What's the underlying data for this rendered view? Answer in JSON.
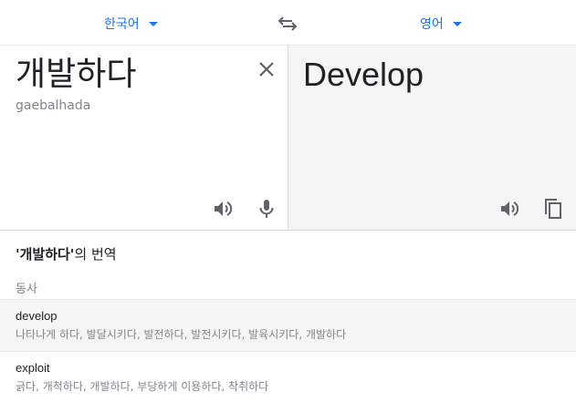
{
  "lang_bar": {
    "source_language": "한국어",
    "target_language": "영어"
  },
  "source": {
    "text": "개발하다",
    "romanization": "gaebalhada"
  },
  "target": {
    "text": "Develop"
  },
  "dictionary": {
    "title_quoted": "개발하다",
    "title_open_quote": "'",
    "title_close_quote": "'",
    "title_suffix": "의 번역",
    "part_of_speech": "동사",
    "entries": [
      {
        "word": "develop",
        "meanings": "나타나게 하다, 발달시키다, 발전하다, 발전시키다, 발육시키다, 개발하다"
      },
      {
        "word": "exploit",
        "meanings": "긁다, 개척하다, 개발하다, 부당하게 이용하다, 착취하다"
      }
    ]
  },
  "colors": {
    "accent": "#1a73e8",
    "icon": "#5f6368",
    "muted_text": "#80868b",
    "target_bg": "#f5f5f5"
  }
}
